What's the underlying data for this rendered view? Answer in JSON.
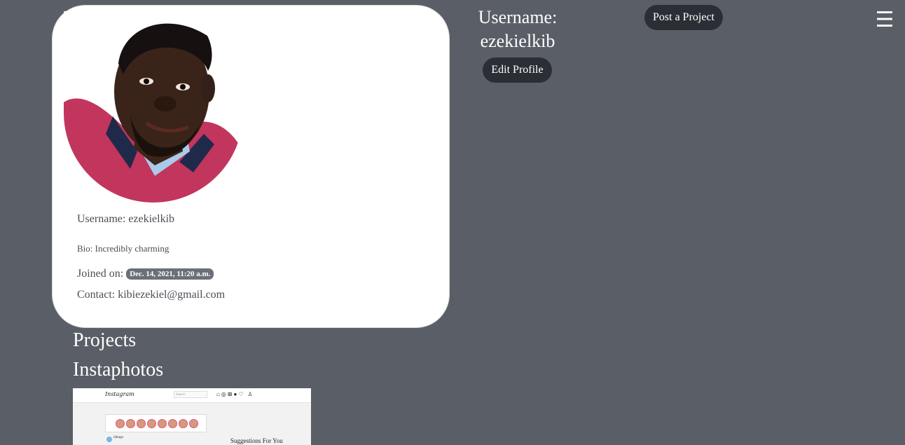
{
  "header": {
    "username_line1": "Username:",
    "username_line2": "ezekielkib",
    "edit_profile_label": "Edit Profile",
    "post_project_label": "Post a Project",
    "menu_icon": "hamburger-menu-icon",
    "menu_glyph": "☰"
  },
  "profile_card": {
    "avatar": "profile-photo",
    "username": "Username: ezekielkib",
    "bio": "Bio: Incredibly charming",
    "joined_label": "Joined on:",
    "joined_date": "Dec. 14, 2021, 11:20 a.m.",
    "contact": "Contact: kibiezekiel@gmail.com"
  },
  "projects": {
    "heading": "Projects",
    "items": [
      {
        "title": "Instaphotos",
        "screenshot": {
          "logo": "Instagram",
          "search_placeholder": "Search",
          "suggestions_label": "Suggestions For You",
          "post_user": "ildrago"
        }
      }
    ]
  },
  "colors": {
    "page_background": "#5a5e66",
    "card_background": "#ffffff",
    "button_background": "#2b2f35",
    "badge_background": "#6b7078",
    "card_text": "#4a4e55"
  }
}
